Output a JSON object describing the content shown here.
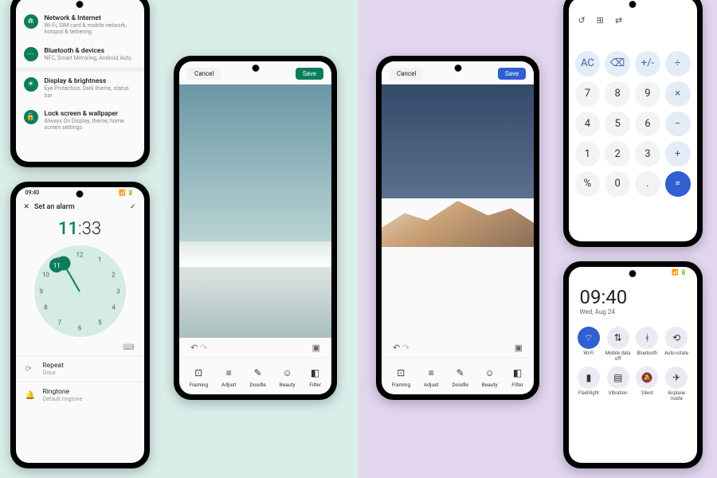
{
  "colors": {
    "accent_green": "#0a7e5a",
    "accent_blue": "#2f5fd0",
    "bg_left": "#d9ede9",
    "bg_right": "#e2d6ef"
  },
  "settings": {
    "items": [
      {
        "title": "Network & Internet",
        "sub": "Wi-Fi, SIM card & mobile network, hotspot & tethering",
        "icon": "wifi-icon"
      },
      {
        "title": "Bluetooth & devices",
        "sub": "NFC, Smart Mirroring, Android Auto",
        "icon": "devices-icon"
      },
      {
        "title": "Display & brightness",
        "sub": "Eye Protection, Dark theme, status bar",
        "icon": "sun-icon"
      },
      {
        "title": "Lock screen & wallpaper",
        "sub": "Always On Display, theme, home screen settings",
        "icon": "lock-icon"
      }
    ]
  },
  "alarm": {
    "status_time": "09:40",
    "header": "Set an alarm",
    "close_glyph": "✕",
    "confirm_glyph": "✓",
    "hour": "11",
    "sep": ":",
    "minute": "33",
    "clock_numbers": [
      "12",
      "1",
      "2",
      "3",
      "4",
      "5",
      "6",
      "7",
      "8",
      "9",
      "10",
      "11"
    ],
    "selected_hour": "11",
    "options": [
      {
        "icon": "repeat-icon",
        "title": "Repeat",
        "sub": "Once"
      },
      {
        "icon": "bell-icon",
        "title": "Ringtone",
        "sub": "Default ringtone"
      }
    ]
  },
  "editor_a": {
    "cancel": "Cancel",
    "save": "Save",
    "undo_glyph": "↶",
    "redo_glyph": "↷",
    "compare_glyph": "▣",
    "tools": [
      {
        "label": "Framing",
        "glyph": "�framing"
      },
      {
        "label": "Adjust",
        "glyph": "⚙"
      },
      {
        "label": "Doodle",
        "glyph": "✎"
      },
      {
        "label": "Beauty",
        "glyph": "☺"
      },
      {
        "label": "Filter",
        "glyph": "◧"
      }
    ]
  },
  "editor_b": {
    "cancel": "Cancel",
    "save": "Save",
    "undo_glyph": "↶",
    "redo_glyph": "↷",
    "compare_glyph": "▣",
    "tools": [
      {
        "label": "Framing"
      },
      {
        "label": "Adjust"
      },
      {
        "label": "Doodle"
      },
      {
        "label": "Beauty"
      },
      {
        "label": "Filter"
      }
    ]
  },
  "calculator": {
    "top_icons": [
      "history-icon",
      "grid-icon",
      "convert-icon"
    ],
    "keys": [
      {
        "t": "AC",
        "cls": "fn"
      },
      {
        "t": "⌫",
        "cls": "fn"
      },
      {
        "t": "+/-",
        "cls": "fn"
      },
      {
        "t": "÷",
        "cls": "fn"
      },
      {
        "t": "7",
        "cls": "num"
      },
      {
        "t": "8",
        "cls": "num"
      },
      {
        "t": "9",
        "cls": "num"
      },
      {
        "t": "×",
        "cls": "fn"
      },
      {
        "t": "4",
        "cls": "num"
      },
      {
        "t": "5",
        "cls": "num"
      },
      {
        "t": "6",
        "cls": "num"
      },
      {
        "t": "−",
        "cls": "fn"
      },
      {
        "t": "1",
        "cls": "num"
      },
      {
        "t": "2",
        "cls": "num"
      },
      {
        "t": "3",
        "cls": "num"
      },
      {
        "t": "+",
        "cls": "fn"
      },
      {
        "t": "%",
        "cls": "num"
      },
      {
        "t": "0",
        "cls": "num"
      },
      {
        "t": ".",
        "cls": "num"
      },
      {
        "t": "=",
        "cls": "eq"
      }
    ]
  },
  "quicksettings": {
    "time": "09:40",
    "date": "Wed, Aug 24",
    "tiles": [
      {
        "label": "Wi-Fi",
        "icon": "wifi-icon",
        "on": true
      },
      {
        "label": "Mobile data off",
        "icon": "data-icon",
        "on": false
      },
      {
        "label": "Bluetooth",
        "icon": "bluetooth-icon",
        "on": false
      },
      {
        "label": "Auto-rotate",
        "icon": "rotate-icon",
        "on": false
      },
      {
        "label": "Flashlight",
        "icon": "flashlight-icon",
        "on": false
      },
      {
        "label": "Vibration",
        "icon": "vibration-icon",
        "on": false
      },
      {
        "label": "Silent",
        "icon": "silent-icon",
        "on": false
      },
      {
        "label": "Airplane mode",
        "icon": "airplane-icon",
        "on": false
      }
    ]
  }
}
